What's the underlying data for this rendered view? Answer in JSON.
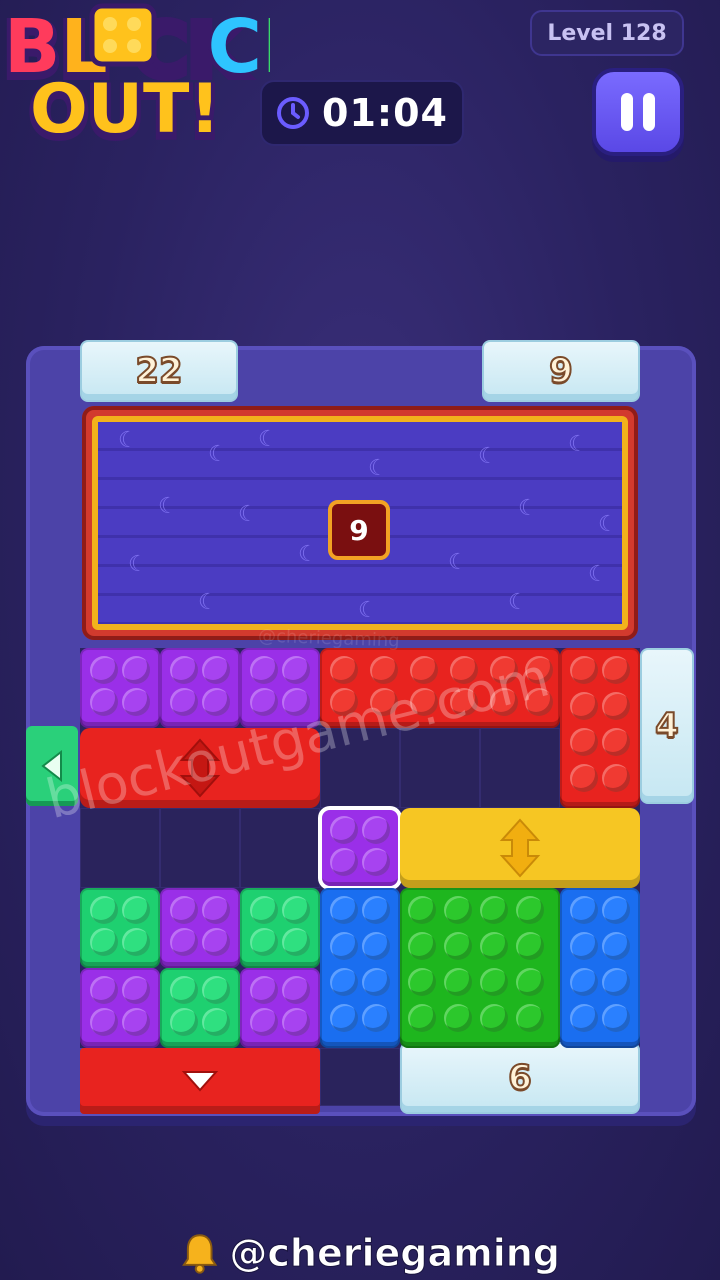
{
  "logo": {
    "line1": "BLOCK",
    "line2": "OUT!"
  },
  "header": {
    "level_label": "Level 128",
    "timer": "01:04"
  },
  "gates": {
    "top_left": "22",
    "top_right": "9",
    "right": "4",
    "bottom": "6"
  },
  "locked_block": {
    "counter": "9"
  },
  "watermark": {
    "text": "blockoutgame.com",
    "faint_text": "@cheriegaming"
  },
  "footer": {
    "handle": "@cheriegaming"
  },
  "colors": {
    "background": "#2a2260",
    "board": "#4c43a8",
    "purple": "#9a2fe8",
    "red": "#e8231f",
    "green": "#1ed070",
    "blue": "#1a6ef0",
    "yellow": "#f6c623",
    "accent": "#6b5cff"
  }
}
